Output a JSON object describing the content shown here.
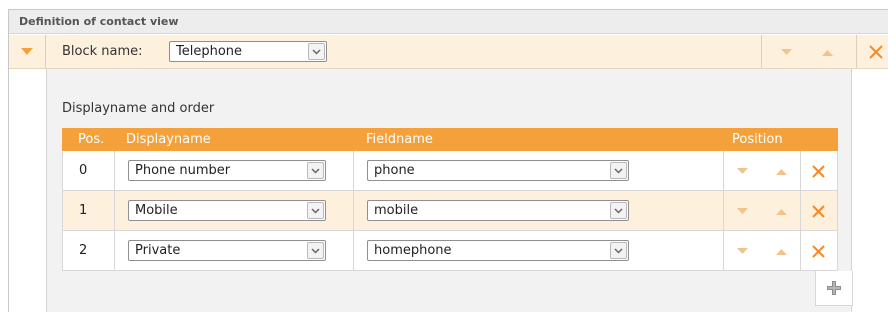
{
  "panel": {
    "title": "Definition of contact view"
  },
  "block": {
    "name_label": "Block name:",
    "selected": "Telephone"
  },
  "section": {
    "label": "Displayname and order"
  },
  "table": {
    "headers": {
      "pos": "Pos.",
      "displayname": "Displayname",
      "fieldname": "Fieldname",
      "position": "Position"
    },
    "rows": [
      {
        "pos": "0",
        "displayname": "Phone number",
        "fieldname": "phone"
      },
      {
        "pos": "1",
        "displayname": "Mobile",
        "fieldname": "mobile"
      },
      {
        "pos": "2",
        "displayname": "Private",
        "fieldname": "homephone"
      }
    ]
  },
  "icons": {
    "collapse": "chevron-down-icon",
    "move_down": "chevron-down-icon",
    "move_up": "chevron-up-icon",
    "delete": "close-icon",
    "add": "plus-icon",
    "dropdown": "dropdown-arrow-icon"
  },
  "colors": {
    "accent": "#f5a13b",
    "row_highlight": "#fdf0dd",
    "arrow_light": "#f0c48c",
    "delete": "#f28a2a"
  }
}
